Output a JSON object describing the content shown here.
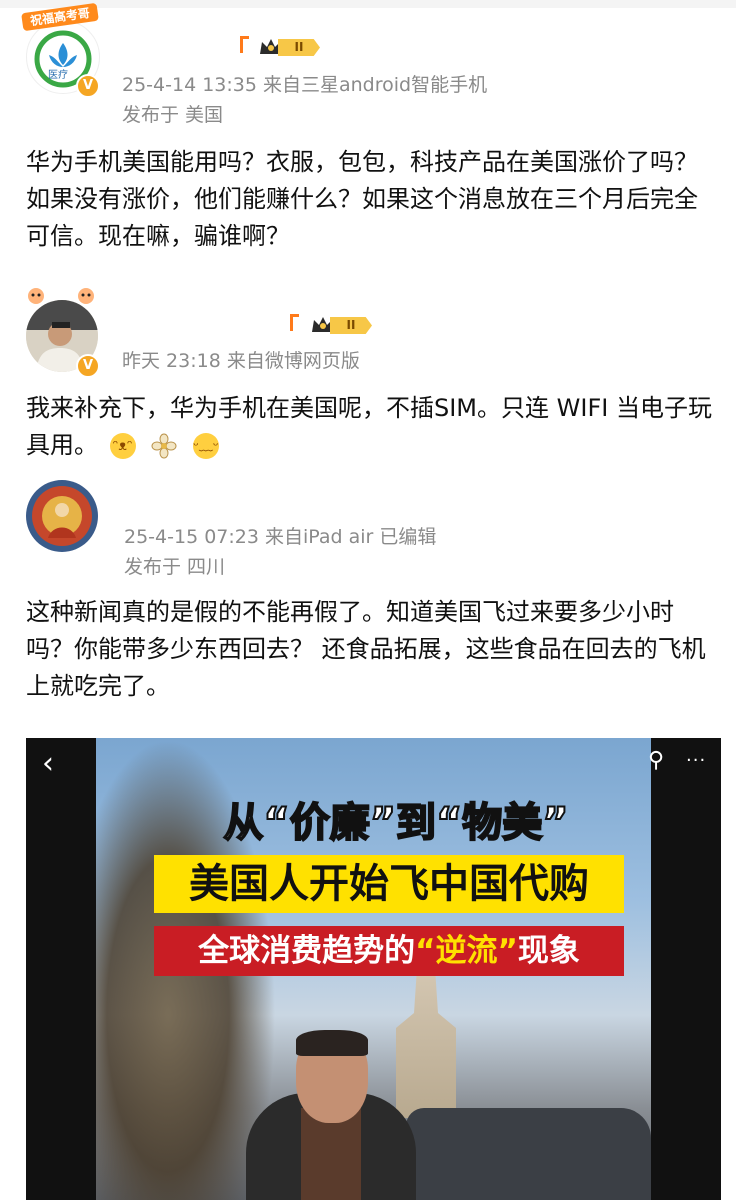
{
  "posts": [
    {
      "time_source": "25-4-14 13:35 来自三星android智能手机",
      "location": "发布于 美国",
      "avatar_label": "医疗",
      "avatar_banner": "祝福高考哥",
      "level_badge": "II",
      "text": "华为手机美国能用吗？衣服，包包，科技产品在美国涨价了吗？如果没有涨价，他们能赚什么？如果这个消息放在三个月后完全可信。现在嘛，骗谁啊？"
    },
    {
      "time_source": "昨天 23:18 来自微博网页版",
      "level_badge": "II",
      "text": "我来补充下，华为手机在美国呢，不插SIM。只连 WIFI 当电子玩具用。"
    },
    {
      "time_source": "25-4-15 07:23 来自iPad air 已编辑",
      "location": "发布于 四川",
      "text": "这种新闻真的是假的不能再假了。知道美国飞过来要多少小时吗？你能带多少东西回去？ 还食品拓展，这些食品在回去的飞机上就吃完了。"
    }
  ],
  "media": {
    "line1": "从“价廉”到“物美”",
    "line2": "美国人开始飞中国代购",
    "line3_a": "全球消费趋势的",
    "line3_b": "“逆流”",
    "line3_c": "现象",
    "back_icon": "chevron-left-icon",
    "search_icon": "search-icon",
    "more_icon": "more-icon",
    "back_glyph": "‹",
    "search_glyph": "⚲",
    "more_glyph": "···"
  },
  "colors": {
    "meta_gray": "#8a8a8a",
    "badge_gold": "#f7c747",
    "v_badge": "#f5a623",
    "banner_yellow": "#ffe100",
    "banner_red": "#c91d24"
  }
}
